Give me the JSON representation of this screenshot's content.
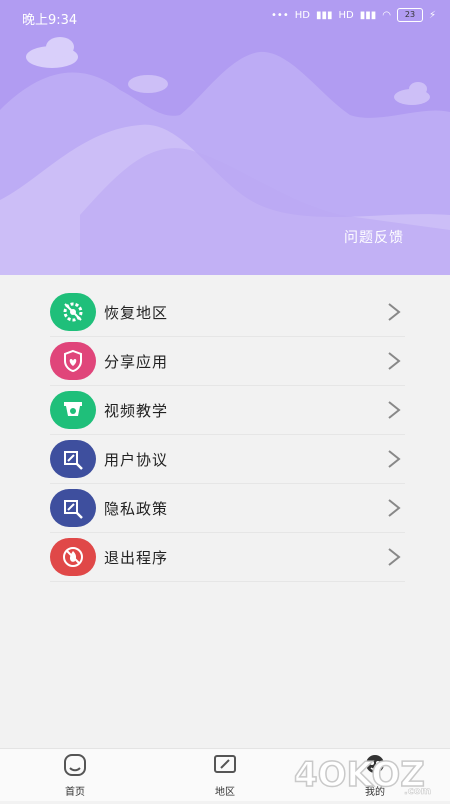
{
  "status_bar": {
    "time": "晚上9:34",
    "signal_text": "HD",
    "battery": "23"
  },
  "header": {
    "feedback_label": "问题反馈"
  },
  "menu": {
    "items": [
      {
        "label": "恢复地区",
        "icon": "settings-gear-icon",
        "color": "#1fbf7a"
      },
      {
        "label": "分享应用",
        "icon": "shield-heart-icon",
        "color": "#e0457a"
      },
      {
        "label": "视频教学",
        "icon": "camera-icon",
        "color": "#1fbf7a"
      },
      {
        "label": "用户协议",
        "icon": "document-search-icon",
        "color": "#3e4f9e"
      },
      {
        "label": "隐私政策",
        "icon": "document-search-icon",
        "color": "#3e4f9e"
      },
      {
        "label": "退出程序",
        "icon": "no-fire-icon",
        "color": "#e04848"
      }
    ]
  },
  "tab_bar": {
    "tabs": [
      {
        "label": "首页",
        "icon": "home-icon"
      },
      {
        "label": "地区",
        "icon": "map-pen-icon"
      },
      {
        "label": "我的",
        "icon": "profile-face-icon"
      }
    ]
  },
  "watermark": "4OKOZ",
  "watermark_suffix": ".com"
}
